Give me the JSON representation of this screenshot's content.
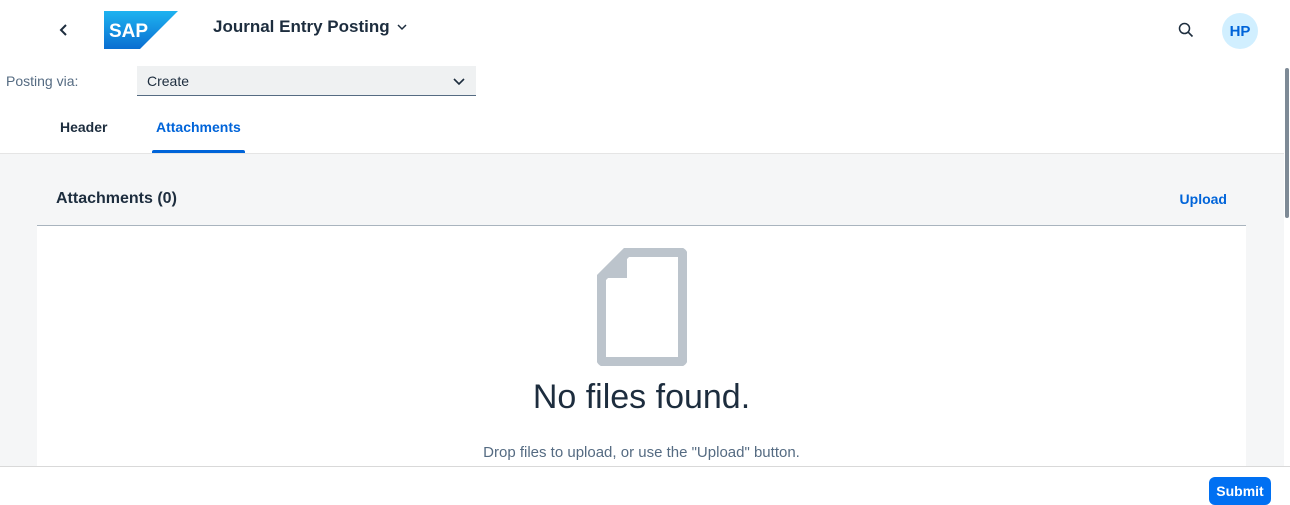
{
  "shell": {
    "logo_text": "SAP",
    "app_title": "Journal Entry Posting",
    "user_initials": "HP"
  },
  "posting": {
    "label": "Posting via:",
    "selected": "Create"
  },
  "tabs": [
    {
      "label": "Header",
      "selected": false
    },
    {
      "label": "Attachments",
      "selected": true
    }
  ],
  "attachments": {
    "title": "Attachments (0)",
    "upload_label": "Upload",
    "empty_title": "No files found.",
    "empty_description": "Drop files to upload, or use the \"Upload\" button."
  },
  "footer": {
    "submit_label": "Submit"
  },
  "colors": {
    "accent": "#0064d9",
    "button": "#0070f2",
    "avatar_bg": "#d1efff"
  },
  "icons": {
    "back": "chevron-left-icon",
    "title_dropdown": "chevron-down-icon",
    "search": "search-icon",
    "select_dropdown": "chevron-down-icon",
    "empty": "document-icon"
  }
}
